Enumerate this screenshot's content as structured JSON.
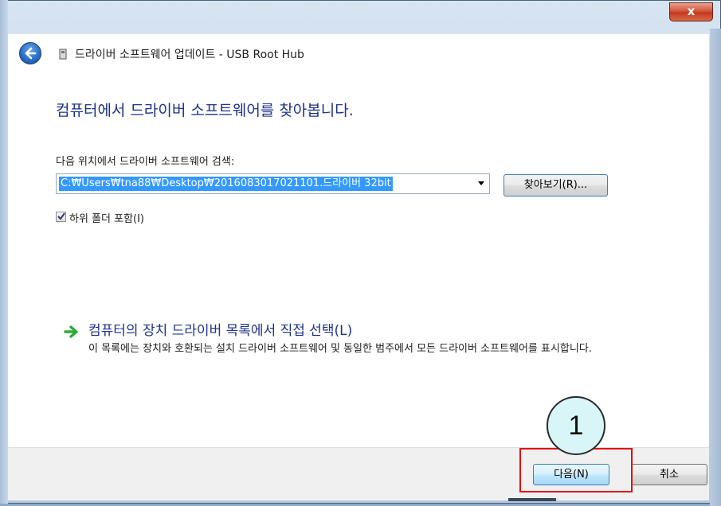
{
  "window": {
    "close_glyph": "x",
    "title": "드라이버 소프트웨어 업데이트 - USB Root Hub",
    "back_icon": "back-arrow-icon",
    "device_icon": "usb-device-icon"
  },
  "main": {
    "heading": "컴퓨터에서 드라이버 소프트웨어를 찾아봅니다.",
    "search_label": "다음 위치에서 드라이버 소프트웨어 검색:",
    "path_value": "C:\\Users\\tna88\\Desktop\\2016083017021101.드라이버 32bit",
    "browse_label": "찾아보기(R)...",
    "include_subfolders_label": "하위 폴더 포함(I)",
    "include_subfolders_checked": true,
    "pick_link_title": "컴퓨터의 장치 드라이버 목록에서 직접 선택(L)",
    "pick_link_desc": "이 목록에는 장치와 호환되는 설치 드라이버 소프트웨어 및 동일한 범주에서 모든 드라이버 소프트웨어를 표시합니다.",
    "pick_link_icon": "green-arrow-icon"
  },
  "footer": {
    "next_label": "다음(N)",
    "cancel_label": "취소"
  },
  "annotation": {
    "step_number": "1",
    "highlight_color": "#e01010"
  }
}
